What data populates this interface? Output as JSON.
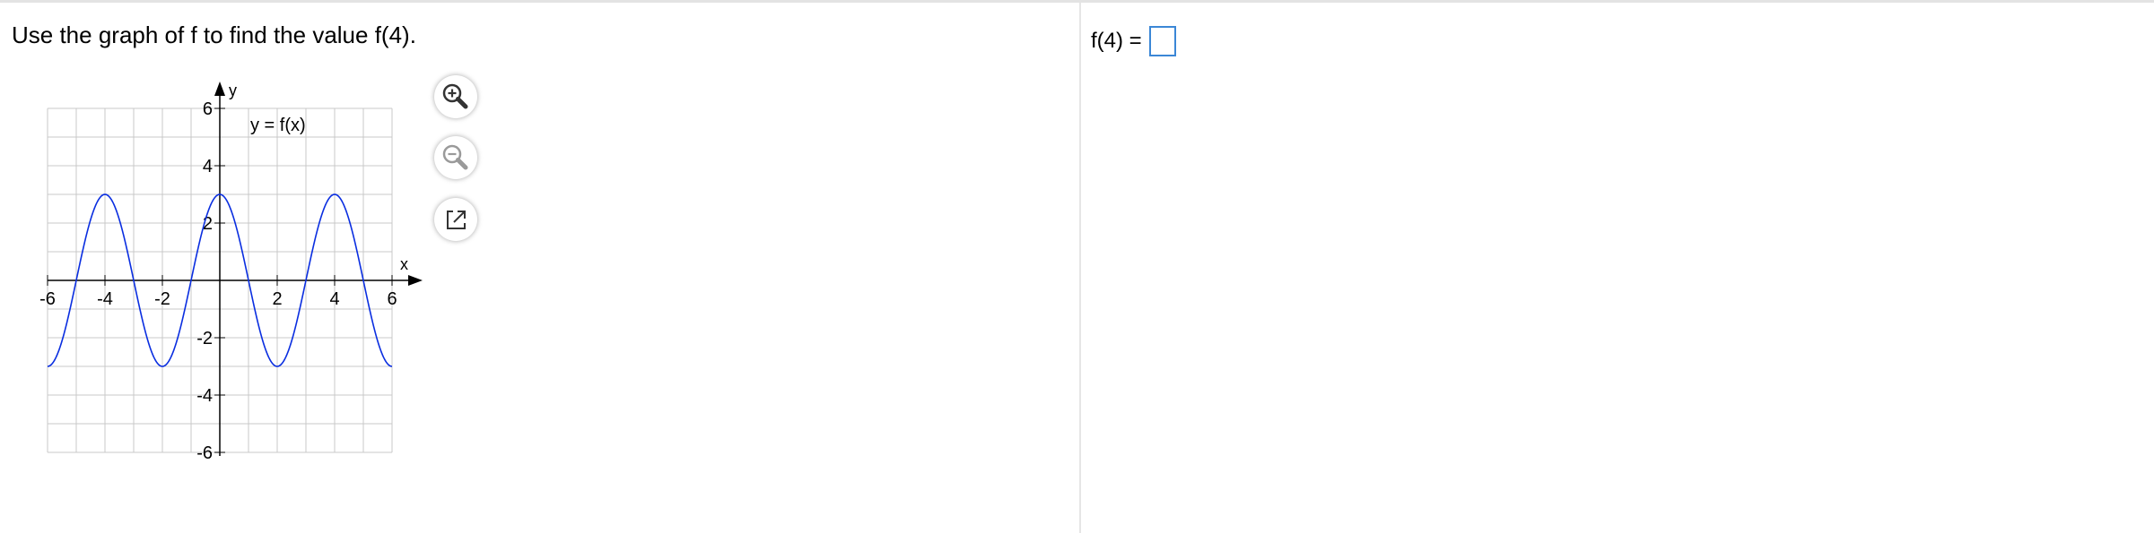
{
  "question": {
    "text": "Use the graph of f to find the value f(4)."
  },
  "answer": {
    "label": "f(4) =",
    "value": ""
  },
  "toolbar": {
    "zoom_in_icon": "zoom-in-icon",
    "zoom_out_icon": "zoom-out-icon",
    "popout_icon": "popout-icon"
  },
  "chart_data": {
    "type": "line",
    "title": "",
    "curve_label": "y = f(x)",
    "xlabel": "x",
    "ylabel": "y",
    "xlim": [
      -6,
      6
    ],
    "ylim": [
      -6,
      6
    ],
    "grid": true,
    "x_ticks": [
      -6,
      -4,
      -2,
      2,
      4,
      6
    ],
    "y_ticks": [
      6,
      4,
      2,
      -2,
      -4,
      -6
    ],
    "x_tick_labels": [
      "-6",
      "-4",
      "-2",
      "2",
      "4",
      "6"
    ],
    "y_tick_labels": [
      "6",
      "4",
      "2",
      "-2",
      "-4",
      "-6"
    ],
    "series": [
      {
        "color": "#0a2ee0",
        "function": "3*cos(pi*x/2)",
        "x": [
          -6,
          -5,
          -4,
          -3,
          -2,
          -1,
          0,
          1,
          2,
          3,
          4,
          5,
          6
        ],
        "y": [
          -3,
          0,
          3,
          0,
          -3,
          0,
          3,
          0,
          -3,
          0,
          3,
          0,
          -3
        ]
      }
    ]
  }
}
